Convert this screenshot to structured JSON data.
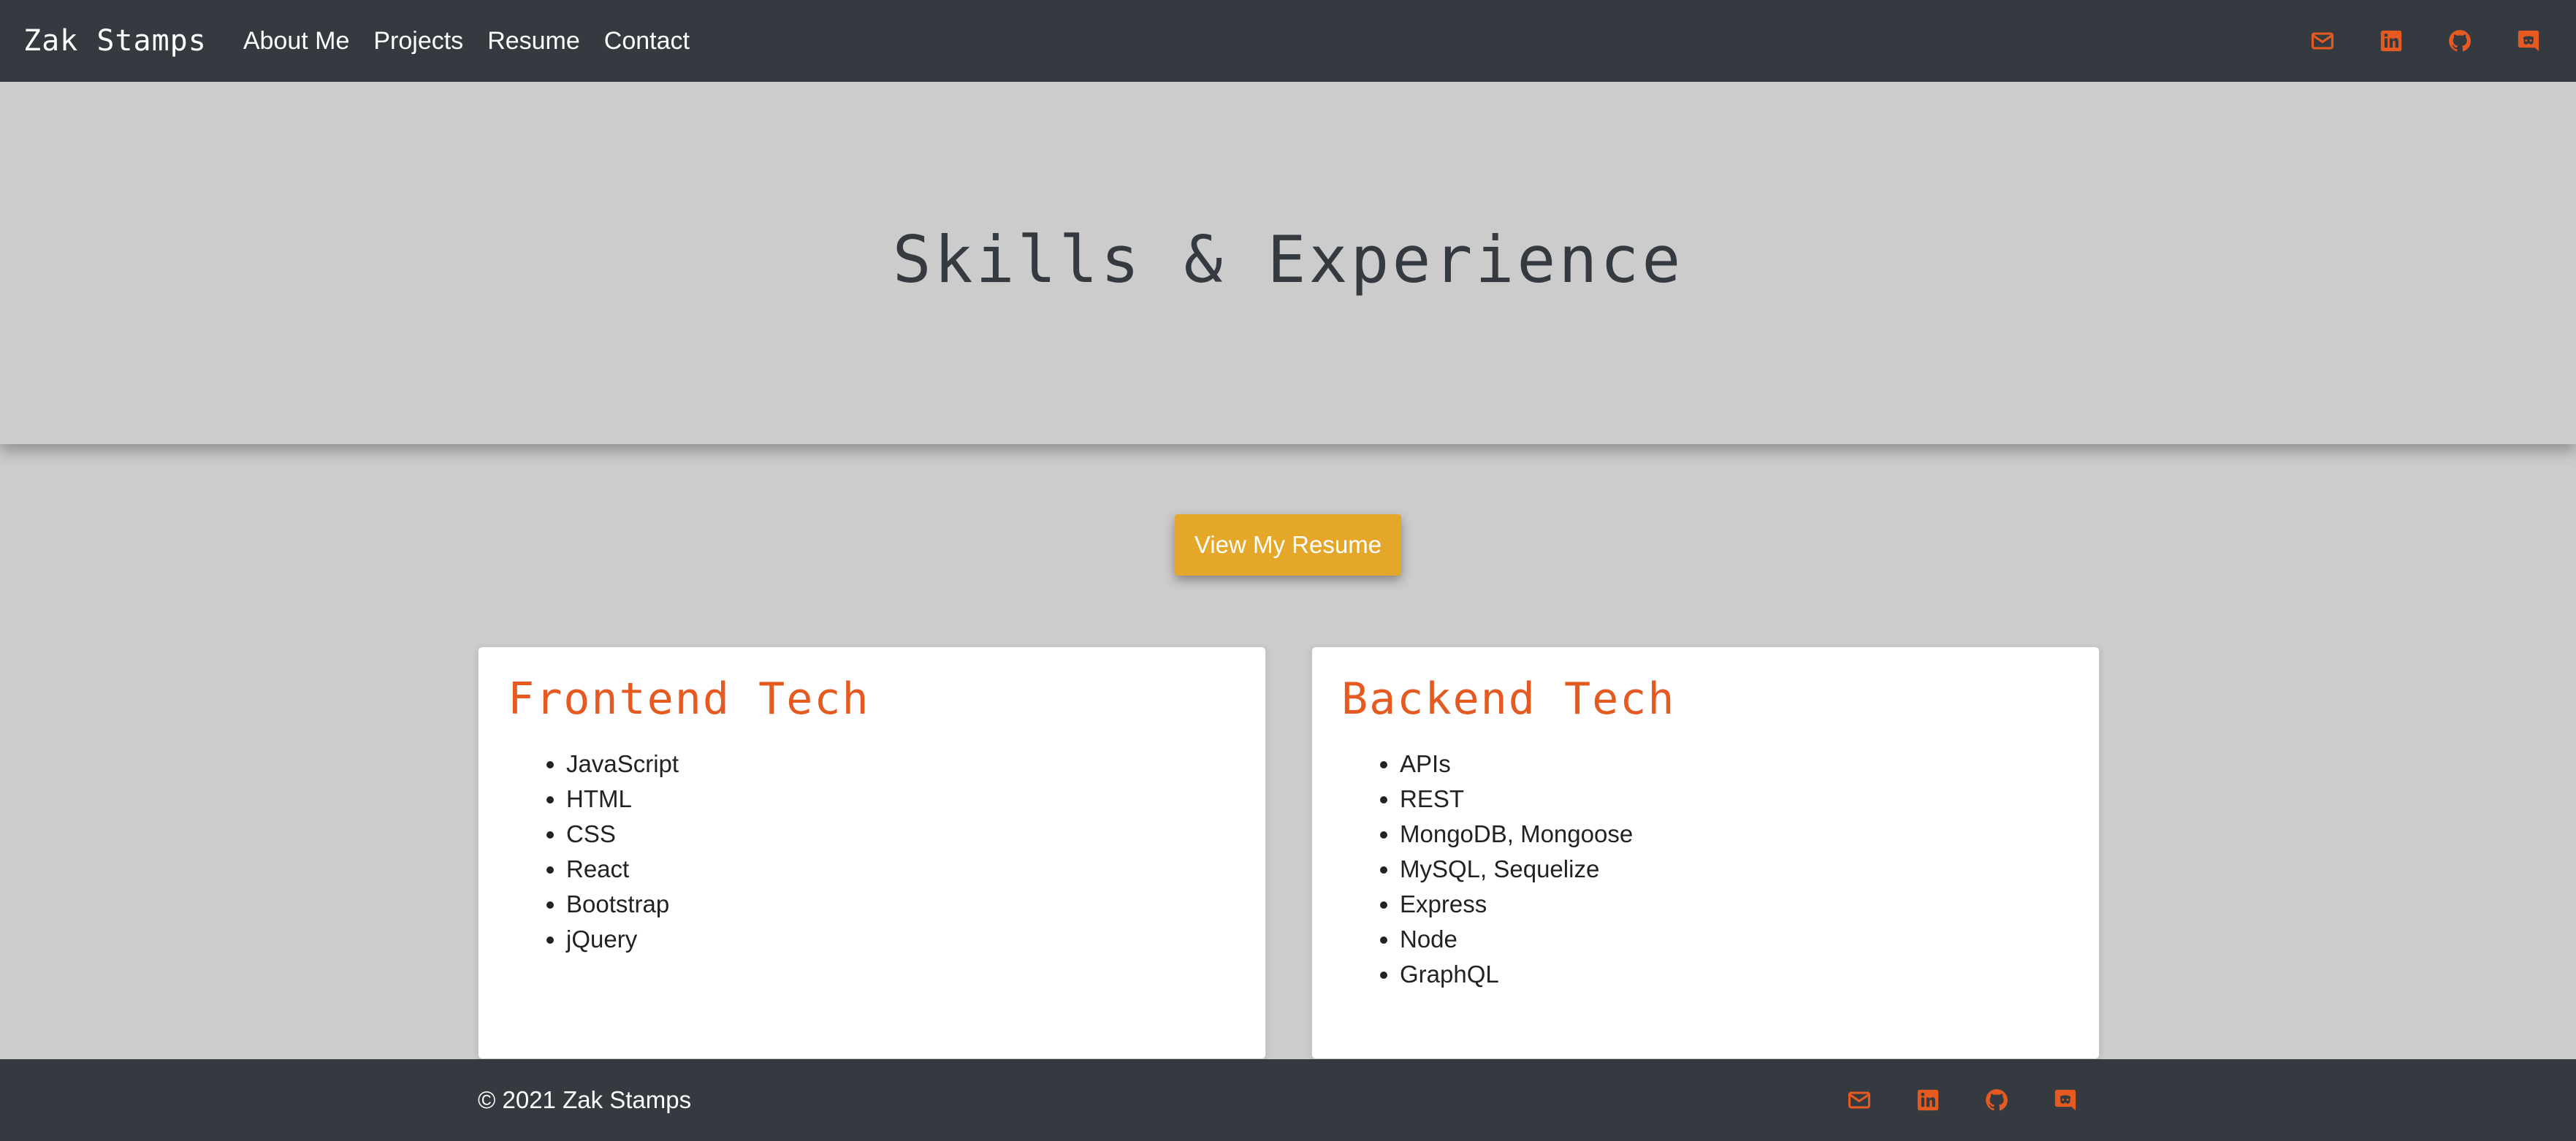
{
  "navbar": {
    "brand": "Zak Stamps",
    "links": [
      "About Me",
      "Projects",
      "Resume",
      "Contact"
    ],
    "icons": [
      "envelope-icon",
      "linkedin-icon",
      "github-icon",
      "discord-icon"
    ]
  },
  "hero": {
    "title": "Skills & Experience"
  },
  "resume_button": {
    "label": "View My Resume"
  },
  "cards": [
    {
      "title": "Frontend Tech",
      "items": [
        "JavaScript",
        "HTML",
        "CSS",
        "React",
        "Bootstrap",
        "jQuery"
      ]
    },
    {
      "title": "Backend Tech",
      "items": [
        "APIs",
        "REST",
        "MongoDB, Mongoose",
        "MySQL, Sequelize",
        "Express",
        "Node",
        "GraphQL"
      ]
    }
  ],
  "footer": {
    "copyright": "© 2021 Zak Stamps",
    "icons": [
      "envelope-icon",
      "linkedin-icon",
      "github-icon",
      "discord-icon"
    ]
  },
  "colors": {
    "navbar_bg": "#343a40",
    "page_bg": "#cccccc",
    "accent_orange": "#e45a21",
    "button_yellow": "#e4a72a"
  }
}
